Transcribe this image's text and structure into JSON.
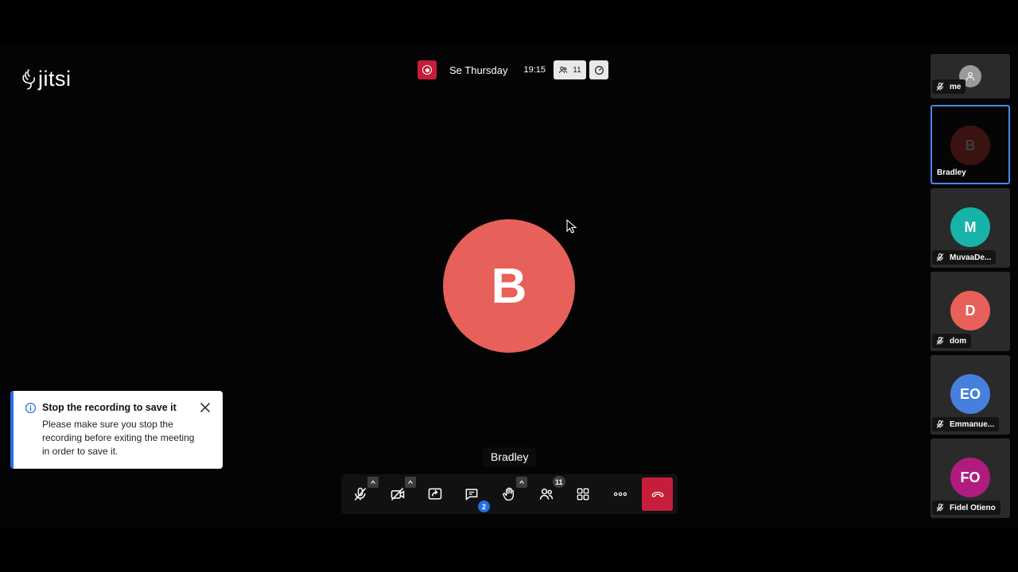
{
  "brand": {
    "logo_text": "jitsi"
  },
  "header": {
    "meeting_name": "Se Thursday",
    "time": "19:15",
    "participant_count": "11"
  },
  "stage": {
    "dominant_initial": "B",
    "dominant_name": "Bradley",
    "avatar_color": "#e8605a"
  },
  "toolbar": {
    "chat_unread": "2",
    "participants_count": "11"
  },
  "filmstrip": [
    {
      "name": "me",
      "initial": "",
      "color": "#9a9a9a"
    },
    {
      "name": "Bradley",
      "initial": "B",
      "color": "#3a1210"
    },
    {
      "name": "MuvaaDe...",
      "initial": "M",
      "color": "#17b3a9"
    },
    {
      "name": "dom",
      "initial": "D",
      "color": "#e8605a"
    },
    {
      "name": "Emmanue...",
      "initial": "EO",
      "color": "#4680dc"
    },
    {
      "name": "Fidel Otieno",
      "initial": "FO",
      "color": "#b01c7d"
    }
  ],
  "notification": {
    "title": "Stop the recording to save it",
    "body": "Please make sure you stop the recording before exiting the meeting in order to save it."
  },
  "colors": {
    "accent": "#246fe5",
    "danger": "#c41e3a"
  }
}
